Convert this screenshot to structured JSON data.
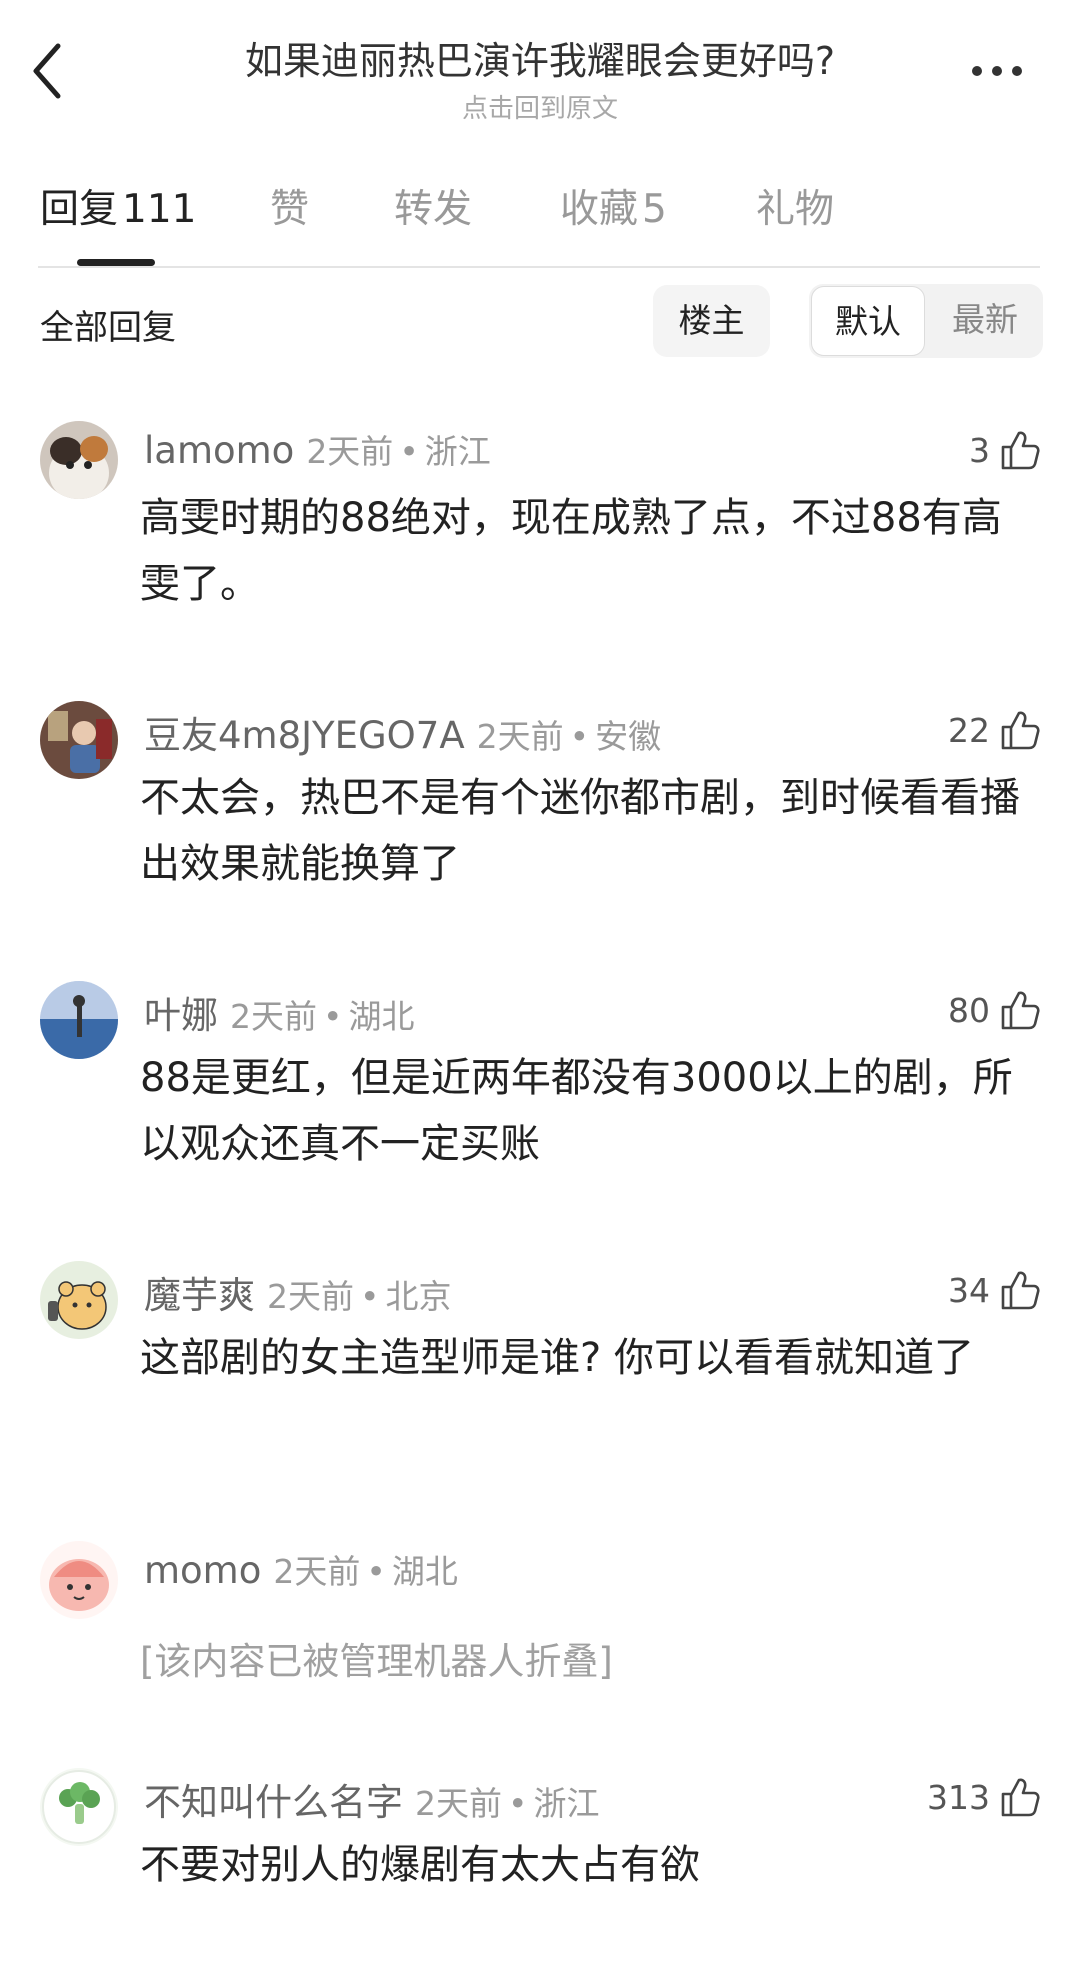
{
  "header": {
    "title": "如果迪丽热巴演许我耀眼会更好吗?",
    "subtitle": "点击回到原文"
  },
  "tabs": [
    {
      "label": "回复",
      "count": "111"
    },
    {
      "label": "赞",
      "count": ""
    },
    {
      "label": "转发",
      "count": ""
    },
    {
      "label": "收藏",
      "count": "5"
    },
    {
      "label": "礼物",
      "count": ""
    }
  ],
  "filter": {
    "label": "全部回复",
    "owner": "楼主",
    "default": "默认",
    "newest": "最新"
  },
  "comments": [
    {
      "name": "lamomo",
      "time": "2天前",
      "location": "浙江",
      "likes": "3",
      "text": "高雯时期的88绝对，现在成熟了点，不过88有高雯了。",
      "avatar": "cat-avatar"
    },
    {
      "name": "豆友4m8JYEGO7A",
      "time": "2天前",
      "location": "安徽",
      "likes": "22",
      "text": "不太会，热巴不是有个迷你都市剧，到时候看看播出效果就能换算了",
      "avatar": "photo-avatar"
    },
    {
      "name": "叶娜",
      "time": "2天前",
      "location": "湖北",
      "likes": "80",
      "text": "88是更红，但是近两年都没有3000以上的剧，所以观众还真不一定买账",
      "avatar": "sea-avatar"
    },
    {
      "name": "魔芋爽",
      "time": "2天前",
      "location": "北京",
      "likes": "34",
      "text": "这部剧的女主造型师是谁? 你可以看看就知道了",
      "avatar": "bear-avatar"
    },
    {
      "name": "momo",
      "time": "2天前",
      "location": "湖北",
      "likes": "",
      "text": "[该内容已被管理机器人折叠]",
      "avatar": "pink-avatar"
    },
    {
      "name": "不知叫什么名字",
      "time": "2天前",
      "location": "浙江",
      "likes": "313",
      "text": "不要对别人的爆剧有太大占有欲",
      "avatar": "broccoli-avatar"
    }
  ],
  "dot_separator": "•"
}
